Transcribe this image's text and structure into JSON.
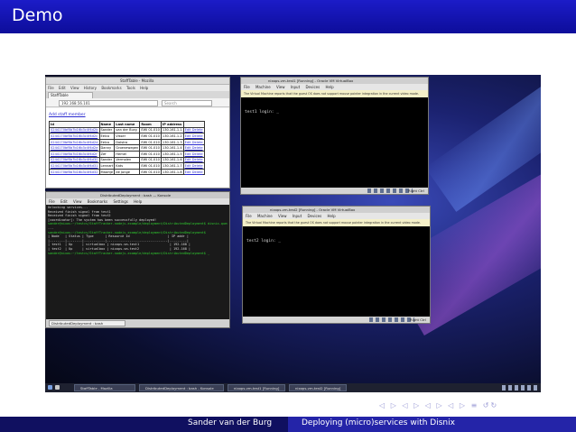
{
  "slide": {
    "title": "Demo",
    "footer_author": "Sander van der Burg",
    "footer_title": "Deploying (micro)services with Disnix",
    "nav_symbols": "◁ ▷ ◁ ▷ ◁ ▷ ◁ ▷ ≡ ↺↻"
  },
  "browser": {
    "window_title": "StaffTable - Mozilla",
    "menu": [
      "File",
      "Edit",
      "View",
      "History",
      "Bookmarks",
      "Tools",
      "Help"
    ],
    "tab_label": "StaffTable",
    "url": "192.168.56.101",
    "search_placeholder": "Search",
    "add_link": "Add staff member",
    "table": {
      "headers": [
        "Id",
        "Name",
        "Last name",
        "Room",
        "IP address",
        ""
      ],
      "rows": [
        [
          "0244170bf8b7b16b3c4f4d2b",
          "Sander",
          "van der Burg",
          "EWI 01.010",
          "130.161.1.1",
          "Edit Delete"
        ],
        [
          "0244170bf8b7b16b3c4f4d2c",
          "Eelco",
          "Visser",
          "EWI 01.010",
          "130.161.1.2",
          "Edit Delete"
        ],
        [
          "0244170bf8b7b16b3c4f4d2d",
          "Eelco",
          "Dolstra",
          "EWI 01.010",
          "130.161.1.3",
          "Edit Delete"
        ],
        [
          "0244170bf8b7b16b3c4f4d2e",
          "Danny",
          "Groenewegen",
          "EWI 01.010",
          "130.161.1.4",
          "Edit Delete"
        ],
        [
          "0244170bf8b7b16b3c4f4d2f",
          "Zef",
          "Hemel",
          "EWI 01.010",
          "130.161.1.5",
          "Edit Delete"
        ],
        [
          "0244170bf8b7b16b3c4f4d30",
          "Sander",
          "Vermolen",
          "EWI 01.010",
          "130.161.1.6",
          "Edit Delete"
        ],
        [
          "0244170bf8b7b16b3c4f4d31",
          "Lennart",
          "Kats",
          "EWI 01.010",
          "130.161.1.7",
          "Edit Delete"
        ],
        [
          "0244170bf8b7b16b3c4f4d32",
          "Maartje",
          "de Jonge",
          "EWI 01.010",
          "130.161.1.8",
          "Edit Delete"
        ]
      ]
    }
  },
  "vm1": {
    "window_title": "nixops-vm-test1 [Running] - Oracle VM VirtualBox",
    "menu": [
      "File",
      "Machine",
      "View",
      "Input",
      "Devices",
      "Help"
    ],
    "info_bar": "The Virtual Machine reports that the guest OS does not support mouse pointer integration in the current video mode.",
    "console": "test1 login: _",
    "host_key": "Right Ctrl"
  },
  "vm2": {
    "window_title": "nixops-vm-test2 [Running] - Oracle VM VirtualBox",
    "menu": [
      "File",
      "Machine",
      "View",
      "Input",
      "Devices",
      "Help"
    ],
    "info_bar": "The Virtual Machine reports that the guest OS does not support mouse pointer integration in the current video mode.",
    "console": "test2 login: _",
    "host_key": "Right Ctrl"
  },
  "konsole": {
    "window_title": "DistributedDeployment : bash — Konsole",
    "menu": [
      "File",
      "Edit",
      "View",
      "Bookmarks",
      "Settings",
      "Help"
    ],
    "lines": [
      "Unlocking services...",
      "Received finish signal from test1",
      "Received finish signal from test2",
      "[coordinator]: The system has been successfully deployed!",
      "",
      "sander@nixos:~/testcs/StaffTracker-nodejs-example/deployment/DistributedDeployment$ disnix-query",
      "...",
      "sander@nixos:~/testcs/StaffTracker-nodejs-example/deployment/DistributedDeployment$ ",
      "",
      "| Node   | Status | Type      | Resource Id                    | IP addr |",
      "|--------|--------|-----------|--------------------------------|---------|",
      "| test1  | Up     | virtualbox | nixops-vm-test1                | 192.168 |",
      "| test2  | Up     | virtualbox | nixops-vm-test2                | 192.168 |",
      "",
      "sander@nixos:~/testcs/StaffTracker-nodejs-example/deployment/DistributedDeployment$ _"
    ],
    "tab_label": "DistributedDeployment : bash"
  },
  "taskbar": {
    "items": [
      "StaffTable - Mozilla",
      "DistributedDeployment : bash - Konsole",
      "nixops-vm-test1 [Running]",
      "nixops-vm-test2 [Running]"
    ]
  }
}
